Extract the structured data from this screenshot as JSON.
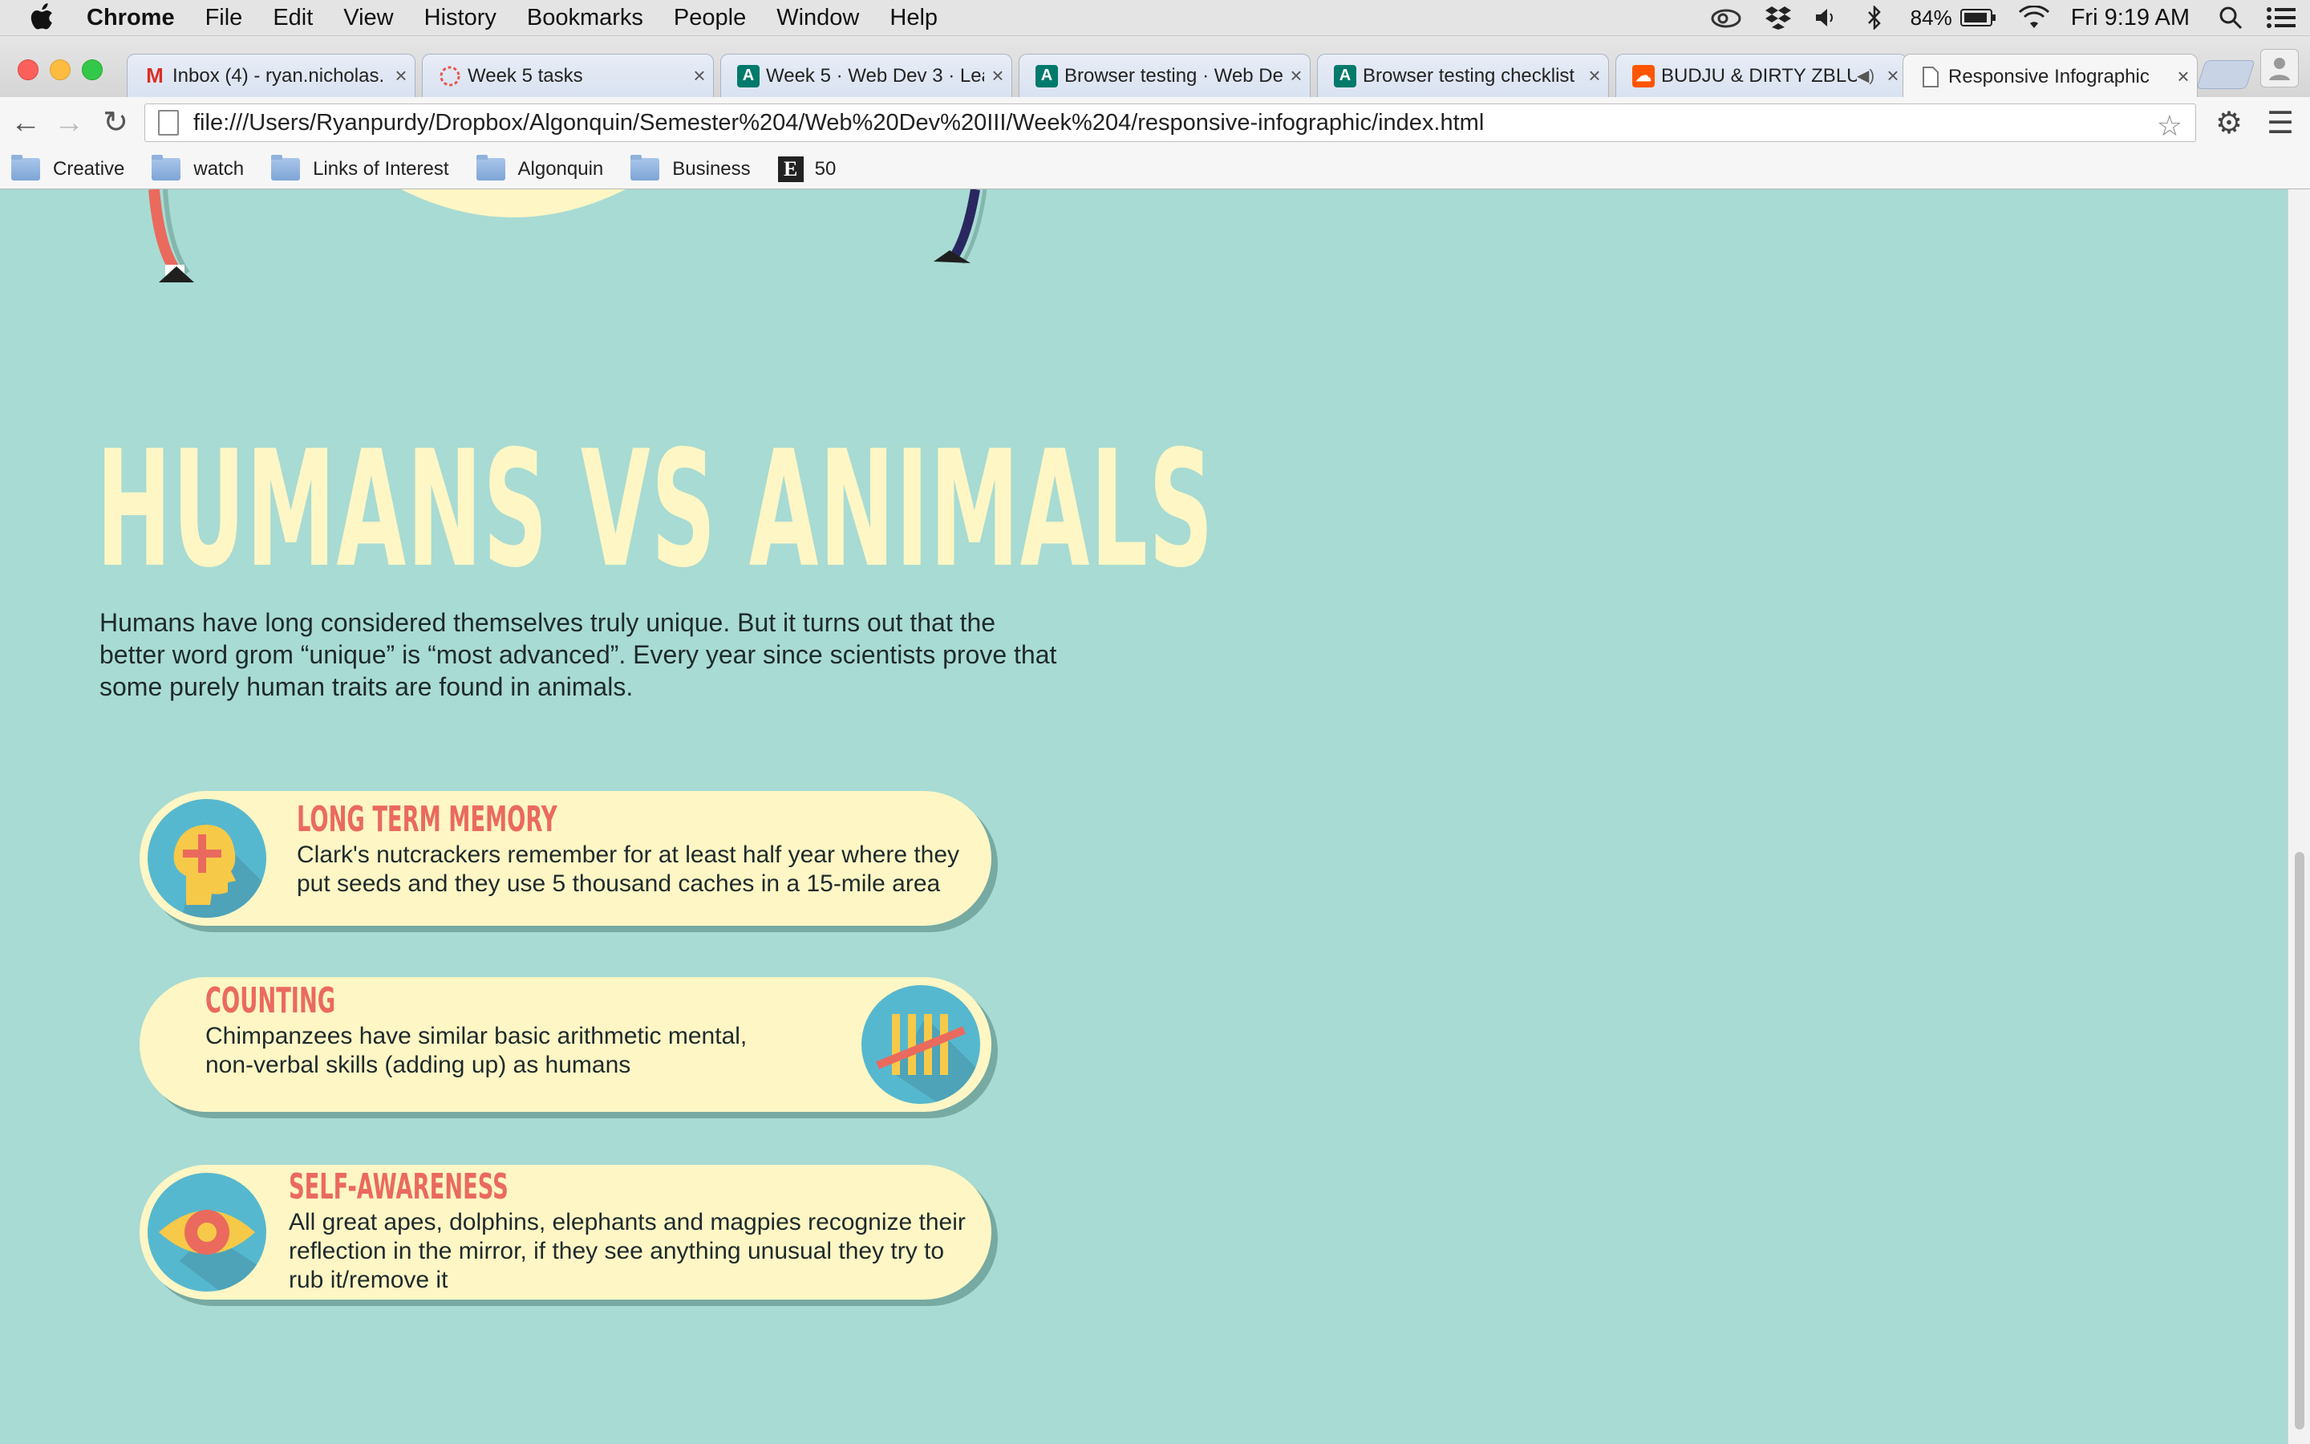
{
  "menubar": {
    "app": "Chrome",
    "items": [
      "File",
      "Edit",
      "View",
      "History",
      "Bookmarks",
      "People",
      "Window",
      "Help"
    ],
    "battery": "84%",
    "clock": "Fri 9:19 AM"
  },
  "tabs": [
    {
      "title": "Inbox (4) - ryan.nicholas.",
      "icon": "gmail-icon"
    },
    {
      "title": "Week 5 tasks",
      "icon": "asana-icon"
    },
    {
      "title": "Week 5 · Web Dev 3 · Lea",
      "icon": "algonquin-icon"
    },
    {
      "title": "Browser testing · Web De",
      "icon": "algonquin-icon"
    },
    {
      "title": "Browser testing checklist",
      "icon": "algonquin-icon"
    },
    {
      "title": "BUDJU & DIRTY ZBLU",
      "icon": "soundcloud-icon"
    },
    {
      "title": "Responsive Infographic",
      "icon": "page-icon"
    }
  ],
  "address_bar": {
    "url": "file:///Users/Ryanpurdy/Dropbox/Algonquin/Semester%204/Web%20Dev%20III/Week%204/responsive-infographic/index.html"
  },
  "bookmarks": [
    "Creative",
    "watch",
    "Links of Interest",
    "Algonquin",
    "Business",
    "50"
  ],
  "page": {
    "headline": "HUMANS VS ANIMALS",
    "intro": "Humans have long considered themselves truly unique. But it turns out that the better word grom “unique” is “most advanced”. Every year since scientists prove that some purely human traits are found in animals.",
    "cards": [
      {
        "title": "LONG TERM MEMORY",
        "text": "Clark's nutcrackers remember for at least half year where they put seeds and they use 5 thousand caches in a 15-mile area",
        "icon": "head-plus-icon"
      },
      {
        "title": "COUNTING",
        "text": "Chimpanzees have similar basic arithmetic mental, non-verbal skills (adding up) as humans",
        "icon": "tally-marks-icon"
      },
      {
        "title": "SELF-AWARENESS",
        "text": "All great apes, dolphins, elephants and magpies recognize their reflection in the mirror, if they see anything unusual they try to rub it/remove it",
        "icon": "eye-icon"
      }
    ]
  },
  "colors": {
    "background": "#a8dbd3",
    "cream": "#fef6c5",
    "coral": "#ea6a5e",
    "icon_blue": "#56b8cf",
    "icon_yellow": "#f7c948"
  }
}
